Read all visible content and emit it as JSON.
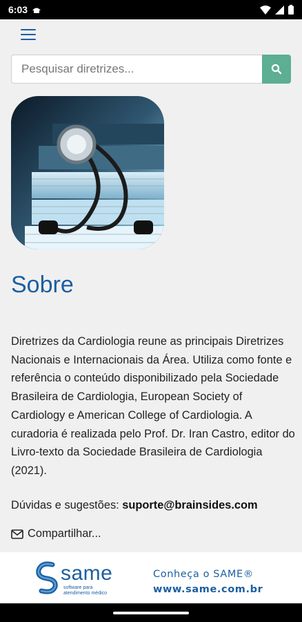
{
  "status_bar": {
    "time": "6:03"
  },
  "search": {
    "placeholder": "Pesquisar diretrizes..."
  },
  "page": {
    "title": "Sobre",
    "description": "Diretrizes da Cardiologia reune as principais Diretrizes Nacionais e Internacionais da Área. Utiliza como fonte e referência o conteúdo disponibilizado pela Sociedade Brasileira de Cardiologia, European Society of Cardiology e American College of Cardiologia. A curadoria é realizada pelo Prof. Dr. Iran Castro, editor do Livro-texto da Sociedade Brasileira de Cardiologia (2021).",
    "contact_label": "Dúvidas e sugestões:",
    "contact_email": "suporte@brainsides.com",
    "share_label": "Compartilhar..."
  },
  "banner": {
    "logo_word": "same",
    "logo_sub_1": "software para",
    "logo_sub_2": "atendimento médico",
    "promo_line": "Conheça o SAME®",
    "promo_url": "www.same.com.br"
  },
  "colors": {
    "accent": "#1c5fa1",
    "search_button": "#5dae93",
    "background": "#f0f0f0"
  }
}
